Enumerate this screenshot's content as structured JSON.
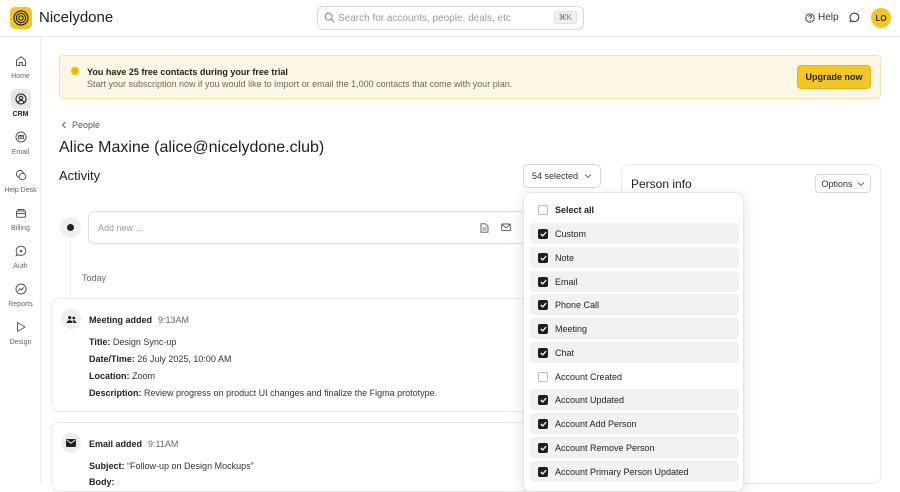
{
  "app": {
    "name": "Nicelydone",
    "avatar_initials": "LO",
    "help_label": "Help"
  },
  "search": {
    "placeholder": "Search for accounts, people, deals, etc",
    "shortcut": "⌘K"
  },
  "sidebar": {
    "items": [
      {
        "label": "Home",
        "icon": "home-icon",
        "active": false
      },
      {
        "label": "CRM",
        "icon": "crm-icon",
        "active": true
      },
      {
        "label": "Email",
        "icon": "email-icon",
        "active": false
      },
      {
        "label": "Help Desk",
        "icon": "help-desk-icon",
        "active": false
      },
      {
        "label": "Billing",
        "icon": "billing-icon",
        "active": false
      },
      {
        "label": "Auth",
        "icon": "auth-icon",
        "active": false
      },
      {
        "label": "Reports",
        "icon": "reports-icon",
        "active": false
      },
      {
        "label": "Design",
        "icon": "design-icon",
        "active": false
      }
    ]
  },
  "banner": {
    "title": "You have 25 free contacts during your free trial",
    "body": "Start your subscription now if you would like to import or email the 1,000 contacts that come with your plan.",
    "cta": "Upgrade now"
  },
  "breadcrumb": {
    "parent": "People"
  },
  "page": {
    "title": "Alice Maxine (alice@nicelydone.club)",
    "section": "Activity"
  },
  "filter": {
    "button_label": "54 selected",
    "options": [
      {
        "label": "Select all",
        "checked": false
      },
      {
        "label": "Custom",
        "checked": true
      },
      {
        "label": "Note",
        "checked": true
      },
      {
        "label": "Email",
        "checked": true
      },
      {
        "label": "Phone Call",
        "checked": true
      },
      {
        "label": "Meeting",
        "checked": true
      },
      {
        "label": "Chat",
        "checked": true
      },
      {
        "label": "Account Created",
        "checked": false
      },
      {
        "label": "Account Updated",
        "checked": true
      },
      {
        "label": "Account Add Person",
        "checked": true
      },
      {
        "label": "Account Remove Person",
        "checked": true
      },
      {
        "label": "Account Primary Person Updated",
        "checked": true
      }
    ]
  },
  "composer": {
    "placeholder": "Add new ..."
  },
  "timeline": {
    "group_label": "Today",
    "cards": [
      {
        "type": "Meeting added",
        "time": "9:13AM",
        "icon": "people-icon",
        "fields": [
          {
            "label": "Title:",
            "value": "Design Sync-up"
          },
          {
            "label": "Date/Time:",
            "value": "26 July 2025, 10:00 AM"
          },
          {
            "label": "Location:",
            "value": "Zoom"
          },
          {
            "label": "Description:",
            "value": "Review progress on product UI changes and finalize the Figma prototype."
          }
        ]
      },
      {
        "type": "Email added",
        "time": "9:11AM",
        "icon": "mail-icon",
        "fields": [
          {
            "label": "Subject:",
            "value": "“Follow-up on Design Mockups”"
          },
          {
            "label": "Body:",
            "value": ""
          }
        ]
      }
    ]
  },
  "person_info": {
    "title": "Person info",
    "options_label": "Options"
  },
  "colors": {
    "accent": "#f5c623",
    "banner_bg": "#fdf8e6",
    "checkbox": "#1e1e1e"
  }
}
